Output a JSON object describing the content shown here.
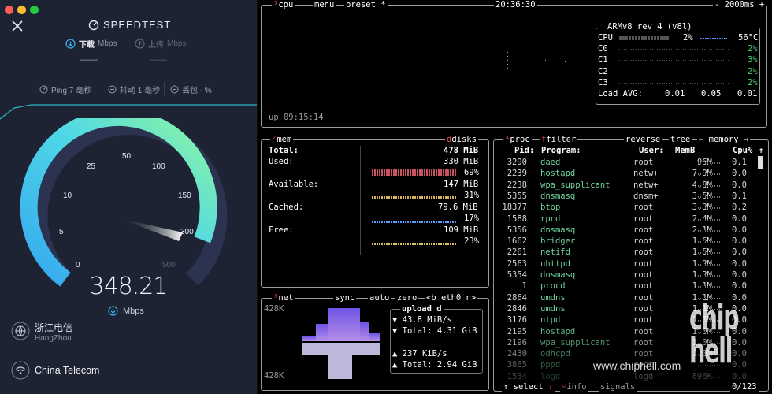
{
  "speedtest": {
    "logo": "SPEEDTEST",
    "download_label": "下载",
    "download_unit": "Mbps",
    "upload_label": "上传",
    "upload_unit": "Mbps",
    "download_value": "——",
    "upload_value": "——",
    "ping": "Ping 7 毫秒",
    "jitter": "抖动 1 毫秒",
    "loss": "丢包 - %",
    "gauge_labels": [
      "0",
      "5",
      "10",
      "25",
      "50",
      "100",
      "150",
      "300",
      "500"
    ],
    "speed": "348.21",
    "speed_unit": "Mbps",
    "isp_name": "浙江电信",
    "isp_city": "HangZhou",
    "carrier": "China Telecom",
    "colors": {
      "accent_green": "#7df2a6",
      "accent_blue": "#3ab4f2",
      "bg": "#1e2333"
    }
  },
  "btop": {
    "cpu_title": "cpu",
    "menu": "menu",
    "preset": "preset *",
    "clock": "20:36:30",
    "interval": "- 2000ms +",
    "uptime": "up 09:15:14",
    "cpu_model": "ARMv8 rev 4 (v8l)",
    "cpu_rows": [
      {
        "name": "CPU",
        "pct": "2%",
        "temp": "56°C"
      },
      {
        "name": "C0",
        "pct": "2%"
      },
      {
        "name": "C1",
        "pct": "3%"
      },
      {
        "name": "C2",
        "pct": "2%"
      },
      {
        "name": "C3",
        "pct": "2%"
      }
    ],
    "load_label": "Load AVG:",
    "load": [
      "0.01",
      "0.05",
      "0.01"
    ],
    "mem_title": "mem",
    "disks_title": "disks",
    "mem_rows": [
      {
        "label": "Total:",
        "value": "478 MiB"
      },
      {
        "label": "Used:",
        "value": "330 MiB",
        "pct": "69%"
      },
      {
        "label": "Available:",
        "value": "147 MiB",
        "pct": "31%"
      },
      {
        "label": "Cached:",
        "value": "79.6 MiB",
        "pct": "17%"
      },
      {
        "label": "Free:",
        "value": "109 MiB",
        "pct": "23%"
      }
    ],
    "net_title": "net",
    "sync": "sync",
    "auto": "auto",
    "zero": "zero",
    "iface": "<b eth0 n>",
    "net_scale_top": "428K",
    "net_scale_bottom": "428K",
    "net_box_title": "upload d",
    "upload_rate": "43.8 MiB/s",
    "upload_total": "Total: 4.31 GiB",
    "download_rate": "237 KiB/s",
    "download_total": "Total: 2.94 GiB",
    "proc_title": "proc",
    "filter": "filter",
    "reverse": "reverse",
    "tree": "tree",
    "sort": "← memory →",
    "proc_headers": [
      "Pid:",
      "Program:",
      "User:",
      "MemB",
      "Cpu%"
    ],
    "processes": [
      {
        "pid": "3290",
        "name": "daed",
        "user": "root",
        "mem": "96M",
        "cpu": "0.1"
      },
      {
        "pid": "2239",
        "name": "hostapd",
        "user": "netw+",
        "mem": "7.9M",
        "cpu": "0.0"
      },
      {
        "pid": "2238",
        "name": "wpa_supplicant",
        "user": "netw+",
        "mem": "4.8M",
        "cpu": "0.0"
      },
      {
        "pid": "5355",
        "name": "dnsmasq",
        "user": "dnsm+",
        "mem": "3.5M",
        "cpu": "0.1"
      },
      {
        "pid": "18377",
        "name": "btop",
        "user": "root",
        "mem": "3.3M",
        "cpu": "0.2"
      },
      {
        "pid": "1588",
        "name": "rpcd",
        "user": "root",
        "mem": "2.4M",
        "cpu": "0.0"
      },
      {
        "pid": "5356",
        "name": "dnsmasq",
        "user": "root",
        "mem": "2.1M",
        "cpu": "0.0"
      },
      {
        "pid": "1662",
        "name": "bridger",
        "user": "root",
        "mem": "1.6M",
        "cpu": "0.0"
      },
      {
        "pid": "2261",
        "name": "netifd",
        "user": "root",
        "mem": "1.5M",
        "cpu": "0.0"
      },
      {
        "pid": "2563",
        "name": "uhttpd",
        "user": "root",
        "mem": "1.2M",
        "cpu": "0.0"
      },
      {
        "pid": "5354",
        "name": "dnsmasq",
        "user": "root",
        "mem": "1.2M",
        "cpu": "0.0"
      },
      {
        "pid": "1",
        "name": "procd",
        "user": "root",
        "mem": "1.1M",
        "cpu": "0.0"
      },
      {
        "pid": "2864",
        "name": "umdns",
        "user": "root",
        "mem": "1.1M",
        "cpu": "0.0"
      },
      {
        "pid": "2846",
        "name": "umdns",
        "user": "root",
        "mem": "1.1M",
        "cpu": "0.0"
      },
      {
        "pid": "3176",
        "name": "ntpd",
        "user": "root",
        "mem": "1.1M",
        "cpu": "0.0"
      },
      {
        "pid": "2195",
        "name": "hostapd",
        "user": "root",
        "mem": "1.0M",
        "cpu": "0.0"
      },
      {
        "pid": "2196",
        "name": "wpa_supplicant",
        "user": "root",
        "mem": "1.0M",
        "cpu": "0.0"
      },
      {
        "pid": "2430",
        "name": "odhcpd",
        "user": "root",
        "mem": "1.0M",
        "cpu": "0.0"
      },
      {
        "pid": "3865",
        "name": "pppd",
        "user": "root",
        "mem": "",
        "cpu": "0.0"
      },
      {
        "pid": "1534",
        "name": "logd",
        "user": "logd",
        "mem": "896K",
        "cpu": "0.0"
      }
    ],
    "footer_select": "select",
    "footer_info": "info",
    "footer_signals": "signals",
    "footer_count": "0/123",
    "colors": {
      "frame": "#9a9a9a",
      "hot": "#ee4444",
      "ok": "#46c96a"
    }
  },
  "watermark": {
    "site": "www.chiphell.com",
    "logo": "chip hell"
  }
}
